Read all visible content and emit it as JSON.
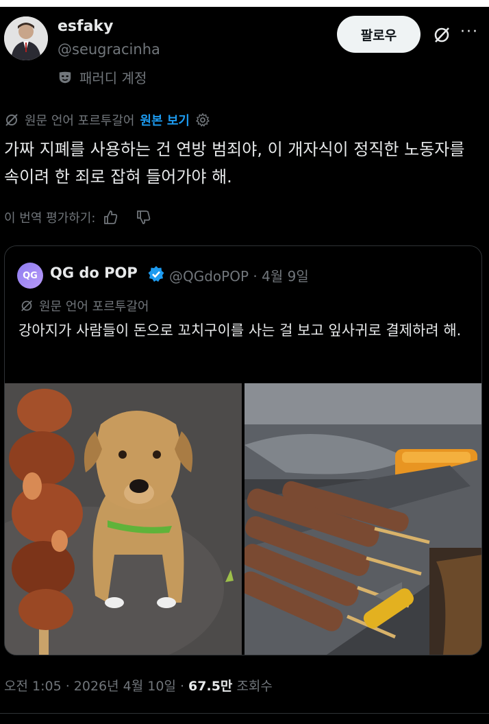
{
  "author": {
    "display_name": "esfaky",
    "handle": "@seugracinha",
    "parody_label": "패러디 계정"
  },
  "actions": {
    "follow_label": "팔로우",
    "more_label": "···"
  },
  "translation": {
    "source_label": "원문 언어 포르투갈어",
    "show_original_label": "원본 보기"
  },
  "tweet": {
    "text": "가짜 지폐를 사용하는 건 연방 범죄야, 이 개자식이 정직한 노동자를 속이려 한 죄로 잡혀 들어가야 해.",
    "rate_translation_label": "이 번역 평가하기:"
  },
  "quote": {
    "avatar_text": "QG",
    "display_name": "QG do POP",
    "handle_date": "@QGdoPOP · 4월 9일",
    "translation_label": "원문 언어 포르투갈어",
    "text": "강아지가 사람들이 돈으로 꼬치구이를 사는 걸 보고 잎사귀로 결제하려 해."
  },
  "meta": {
    "timestamp": "오전 1:05 · 2026년 4월 10일 · ",
    "views_count": "67.5만",
    "views_label": " 조회수"
  },
  "colors": {
    "background": "#000000",
    "text": "#e7e9ea",
    "muted": "#71767b",
    "link": "#1d9bf0",
    "border": "#2f3336"
  }
}
